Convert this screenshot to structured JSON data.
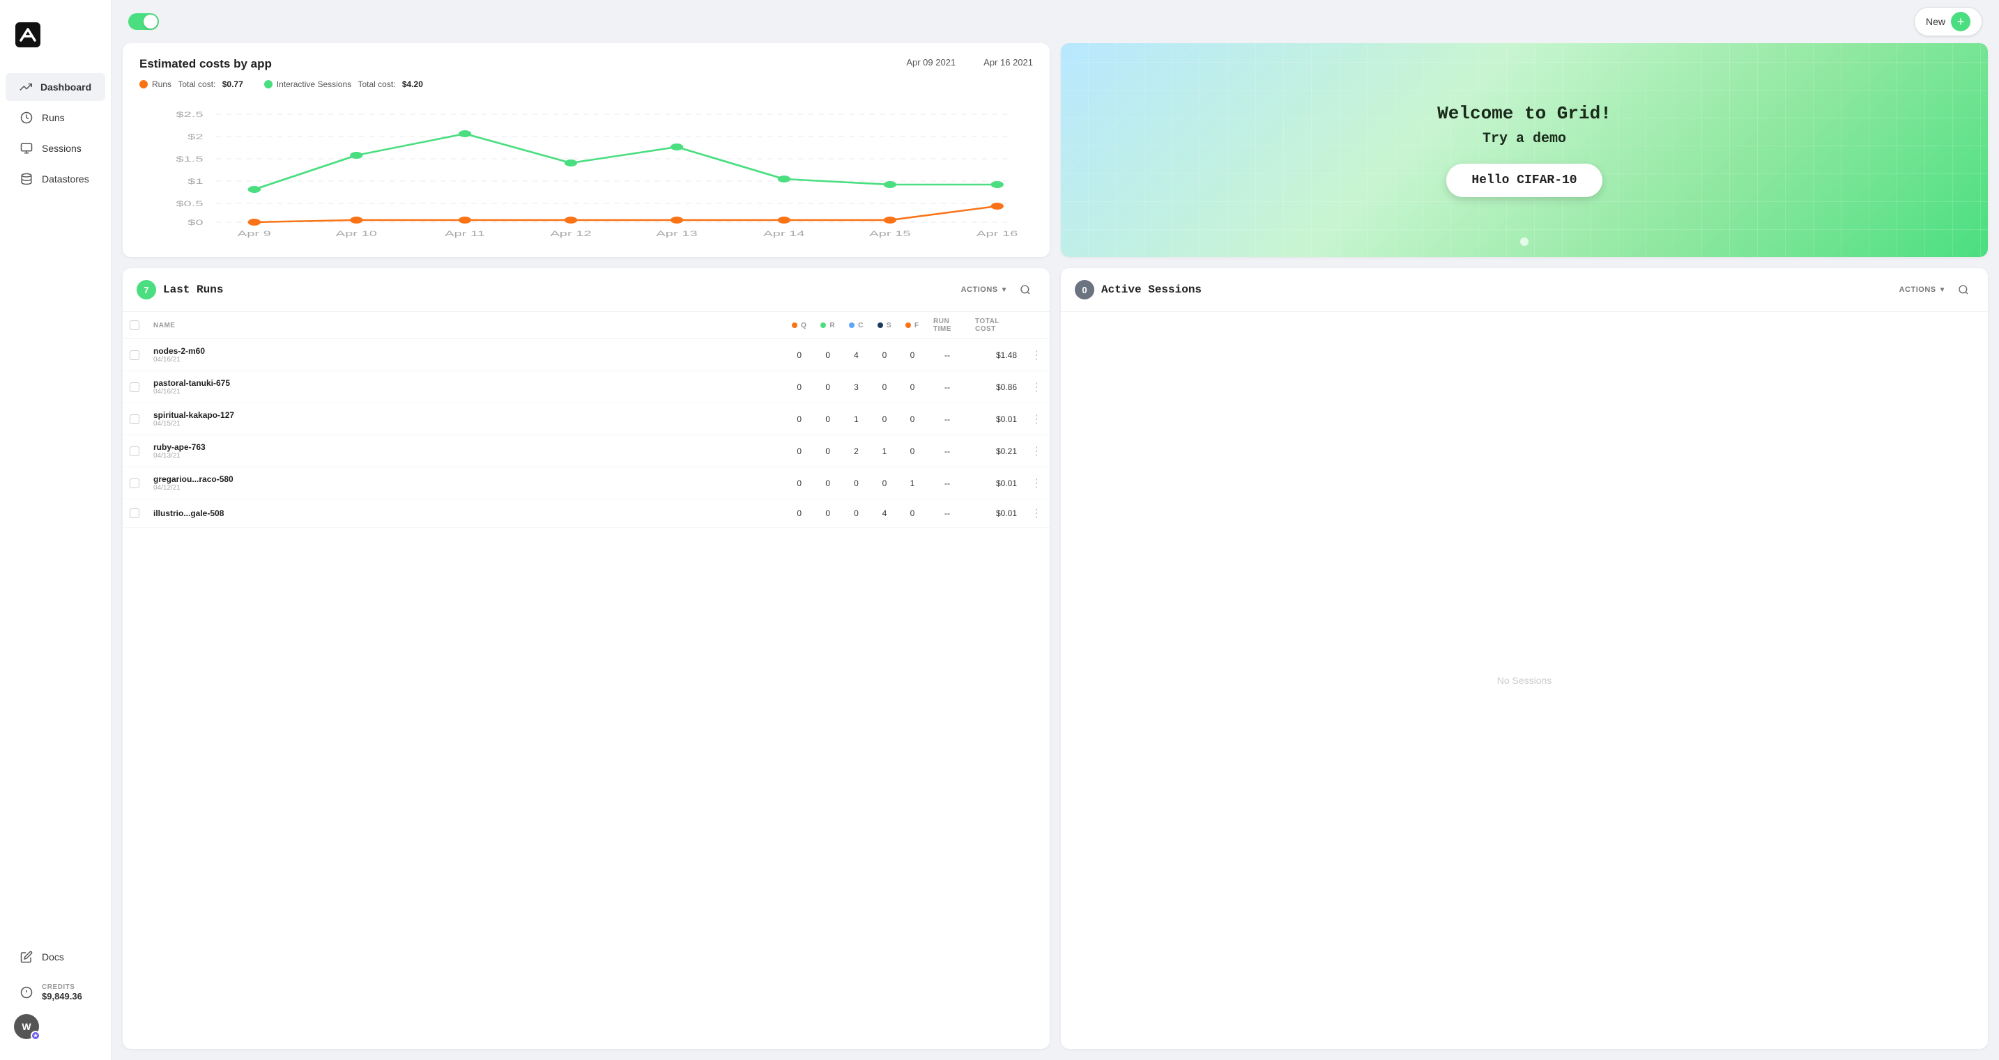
{
  "app": {
    "name": "Grid",
    "logo_alt": "Grid logo"
  },
  "sidebar": {
    "items": [
      {
        "id": "dashboard",
        "label": "Dashboard",
        "icon": "dashboard-icon",
        "active": true
      },
      {
        "id": "runs",
        "label": "Runs",
        "icon": "runs-icon",
        "active": false
      },
      {
        "id": "sessions",
        "label": "Sessions",
        "icon": "sessions-icon",
        "active": false
      },
      {
        "id": "datastores",
        "label": "Datastores",
        "icon": "datastores-icon",
        "active": false
      }
    ],
    "bottom": [
      {
        "id": "docs",
        "label": "Docs",
        "icon": "docs-icon"
      }
    ],
    "credits": {
      "label": "CREDITS",
      "amount": "$9,849.36"
    },
    "user": {
      "initial": "W",
      "has_badge": true
    }
  },
  "topbar": {
    "toggle_label": "toggle",
    "new_button_label": "New",
    "new_button_icon": "plus-icon"
  },
  "cost_chart": {
    "title": "Estimated costs by app",
    "date_start": "Apr 09 2021",
    "date_end": "Apr 16 2021",
    "legend": [
      {
        "id": "runs",
        "label": "Runs",
        "color": "#f97316",
        "cost_label": "Total cost:",
        "cost": "$0.77"
      },
      {
        "id": "interactive",
        "label": "Interactive Sessions",
        "color": "#4ade80",
        "cost_label": "Total cost:",
        "cost": "$4.20"
      }
    ],
    "y_labels": [
      "$2.5",
      "$2",
      "$1.5",
      "$1",
      "$0.5",
      "$0"
    ],
    "x_labels": [
      "Apr 9",
      "Apr 10",
      "Apr 11",
      "Apr 12",
      "Apr 13",
      "Apr 14",
      "Apr 15",
      "Apr 16"
    ],
    "green_line": [
      {
        "x": 0,
        "y": 0.3
      },
      {
        "x": 1,
        "y": 0.62
      },
      {
        "x": 2,
        "y": 0.82
      },
      {
        "x": 3,
        "y": 0.55
      },
      {
        "x": 4,
        "y": 0.7
      },
      {
        "x": 5,
        "y": 0.4
      },
      {
        "x": 6,
        "y": 0.35
      },
      {
        "x": 7,
        "y": 0.35
      }
    ],
    "orange_line": [
      {
        "x": 0,
        "y": 0
      },
      {
        "x": 1,
        "y": 0.05
      },
      {
        "x": 2,
        "y": 0.05
      },
      {
        "x": 3,
        "y": 0.05
      },
      {
        "x": 4,
        "y": 0.05
      },
      {
        "x": 5,
        "y": 0.05
      },
      {
        "x": 6,
        "y": 0.05
      },
      {
        "x": 7,
        "y": 0.15
      }
    ]
  },
  "welcome": {
    "title": "Welcome to Grid!",
    "subtitle": "Try a demo",
    "button_label": "Hello CIFAR-10"
  },
  "last_runs": {
    "badge_count": "7",
    "title": "Last Runs",
    "actions_label": "ACTIONS",
    "columns": {
      "name": "NAME",
      "q": "Q",
      "r": "R",
      "c": "C",
      "s": "S",
      "f": "F",
      "run_time": "RUN TIME",
      "total_cost": "TOTAL COST"
    },
    "col_colors": {
      "q": "#f97316",
      "r": "#4ade80",
      "c": "#60a5fa",
      "s": "#1e3a5f",
      "f": "#f97316"
    },
    "rows": [
      {
        "name": "nodes-2-m60",
        "date": "04/16/21",
        "q": 0,
        "r": 0,
        "c": 4,
        "s": 0,
        "f": 0,
        "run_time": "--",
        "total_cost": "$1.48"
      },
      {
        "name": "pastoral-tanuki-675",
        "date": "04/16/21",
        "q": 0,
        "r": 0,
        "c": 3,
        "s": 0,
        "f": 0,
        "run_time": "--",
        "total_cost": "$0.86"
      },
      {
        "name": "spiritual-kakapo-127",
        "date": "04/15/21",
        "q": 0,
        "r": 0,
        "c": 1,
        "s": 0,
        "f": 0,
        "run_time": "--",
        "total_cost": "$0.01"
      },
      {
        "name": "ruby-ape-763",
        "date": "04/13/21",
        "q": 0,
        "r": 0,
        "c": 2,
        "s": 1,
        "f": 0,
        "run_time": "--",
        "total_cost": "$0.21"
      },
      {
        "name": "gregariou...raco-580",
        "date": "04/12/21",
        "q": 0,
        "r": 0,
        "c": 0,
        "s": 0,
        "f": 1,
        "run_time": "--",
        "total_cost": "$0.01"
      },
      {
        "name": "illustrio...gale-508",
        "date": "",
        "q": 0,
        "r": 0,
        "c": 0,
        "s": 4,
        "f": 0,
        "run_time": "--",
        "total_cost": "$0.01"
      }
    ]
  },
  "active_sessions": {
    "badge_count": "0",
    "title": "Active Sessions",
    "actions_label": "ACTIONS",
    "empty_label": "No Sessions"
  }
}
